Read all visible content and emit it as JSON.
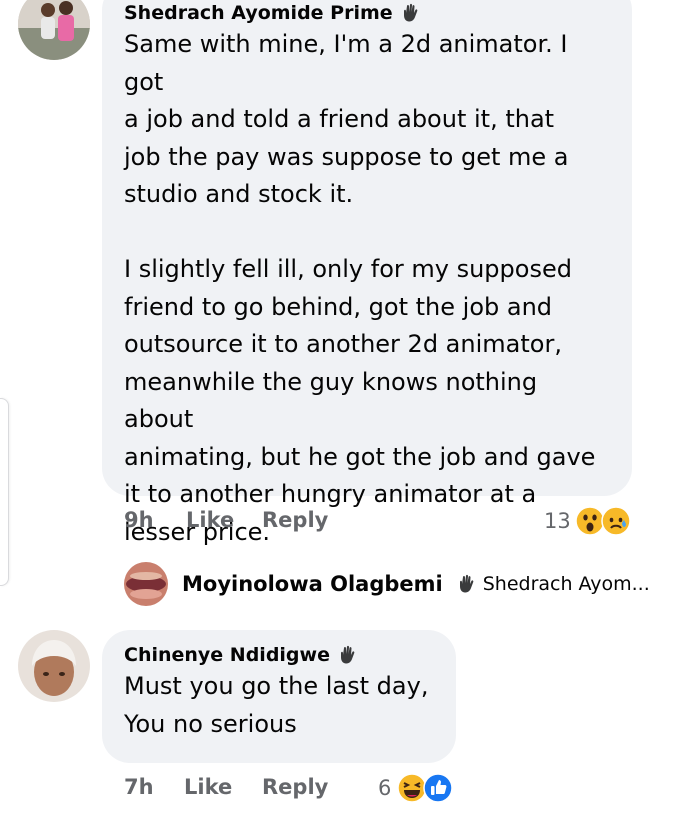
{
  "comments": [
    {
      "author": "Shedrach Ayomide Prime",
      "text": "Same with mine, I'm a 2d animator. I got\na job and told a friend about it, that\njob the pay was suppose to get me a\nstudio and stock it.\n\nI slightly fell ill, only for my supposed\nfriend to go behind, got the job and\noutsource it to another 2d animator,\nmeanwhile the guy knows nothing about\nanimating, but he got the job and gave\nit to another hungry animator at a\nlesser price.",
      "time": "9h",
      "like_label": "Like",
      "reply_label": "Reply",
      "reaction_count": "13",
      "reaction_icons": [
        "wow-emoji-icon",
        "sad-emoji-icon"
      ]
    },
    {
      "author": "Chinenye Ndidigwe",
      "text": "Must you go the last day,\nYou no serious",
      "time": "7h",
      "like_label": "Like",
      "reply_label": "Reply",
      "reaction_count": "6",
      "reaction_icons": [
        "haha-emoji-icon",
        "like-reaction-icon"
      ]
    }
  ],
  "reply_preview": {
    "author": "Moyinolowa Olagbemi",
    "target": "Shedrach Ayom..."
  },
  "colors": {
    "bubble": "#f0f2f5",
    "meta": "#65676b",
    "text": "#050505",
    "like_blue": "#1877f2",
    "emoji_yellow": "#f7b928"
  }
}
